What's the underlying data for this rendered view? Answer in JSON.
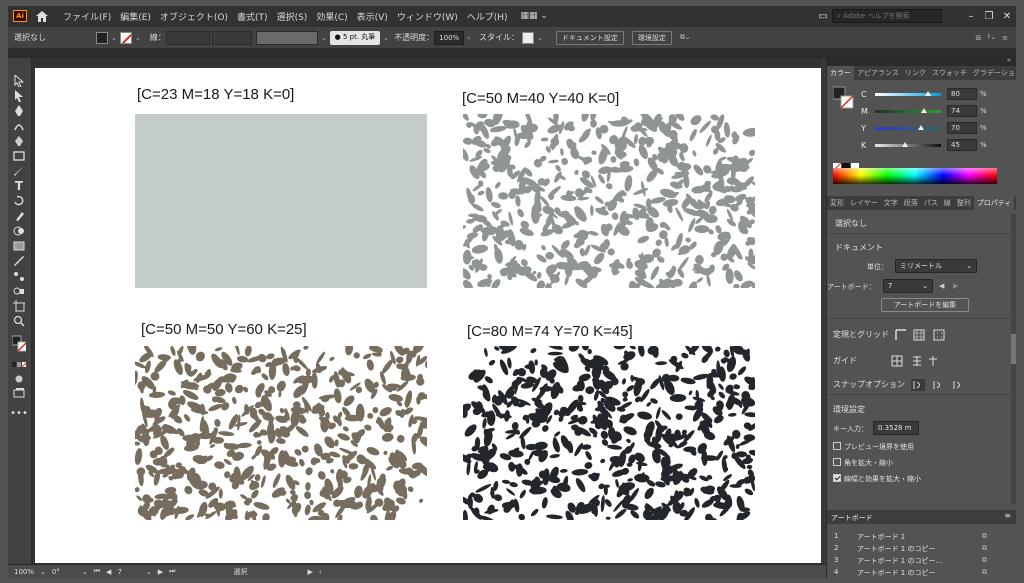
{
  "menubar": {
    "app_logo": "Ai",
    "items": [
      "ファイル(F)",
      "編集(E)",
      "オブジェクト(O)",
      "書式(T)",
      "選択(S)",
      "効果(C)",
      "表示(V)",
      "ウィンドウ(W)",
      "ヘルプ(H)"
    ],
    "search_placeholder": "Adobe ヘルプを検索"
  },
  "controlbar": {
    "selection_label": "選択なし",
    "stroke_label": "線：",
    "brush_label": "5 pt. 丸筆",
    "opacity_label": "不透明度：",
    "opacity_value": "100%",
    "style_label": "スタイル：",
    "doc_setup_button": "ドキュメント設定",
    "prefs_button": "環境設定"
  },
  "canvas": {
    "tiles": [
      {
        "caption": "[C=23 M=18 Y=18 K=0]",
        "color": "#c5cdcc",
        "pattern": "solid"
      },
      {
        "caption": "[C=50 M=40 Y=40 K=0]",
        "color": "#8e9592",
        "pattern": "noise"
      },
      {
        "caption": "[C=50 M=50 Y=60 K=25]",
        "color": "#766d5e",
        "pattern": "noise"
      },
      {
        "caption": "[C=80 M=74 Y=70 K=45]",
        "color": "#23272b",
        "pattern": "noise"
      }
    ]
  },
  "statusbar": {
    "zoom": "100%",
    "rotation": "0°",
    "artboard_num": "7",
    "mode": "選択"
  },
  "color_panel": {
    "tabs": [
      "カラー",
      "アピアランス",
      "リンク",
      "スウォッチ",
      "グラデーション"
    ],
    "channels": [
      {
        "label": "C",
        "value": "80",
        "unit": "%",
        "level": 0.8,
        "gradient": "linear-gradient(to right,#ffffff,#00a0e0)"
      },
      {
        "label": "M",
        "value": "74",
        "unit": "%",
        "level": 0.74,
        "gradient": "linear-gradient(to right,#203030,#2ea02e)"
      },
      {
        "label": "Y",
        "value": "70",
        "unit": "%",
        "level": 0.7,
        "gradient": "linear-gradient(to right,#2b3ad0,#2a6a5a)"
      },
      {
        "label": "K",
        "value": "45",
        "unit": "%",
        "level": 0.45,
        "gradient": "linear-gradient(to right,#e8e8e8,#111111)"
      }
    ]
  },
  "properties_panel": {
    "tabs": [
      "変形",
      "レイヤー",
      "文字",
      "段落",
      "パス",
      "線",
      "整列",
      "プロパティ"
    ],
    "selection": "選択なし",
    "document_heading": "ドキュメント",
    "unit_label": "単位：",
    "unit_value": "ミリメートル",
    "artboard_label": "アートボード：",
    "artboard_value": "7",
    "edit_artboard_button": "アートボードを編集",
    "ruler_grid_label": "定規とグリッド",
    "guides_label": "ガイド",
    "snap_label": "スナップオプション",
    "prefs_heading": "環境設定",
    "key_increment_label": "キー入力：",
    "key_increment_value": "0.3528 m",
    "checkbox_preview": "プレビュー境界を使用",
    "checkbox_corners": "角を拡大・縮小",
    "checkbox_strokes": "線幅と効果を拡大・縮小",
    "checkbox_strokes_checked": true
  },
  "artboard_panel": {
    "title": "アートボード",
    "rows": [
      {
        "num": "1",
        "name": "アートボード 1"
      },
      {
        "num": "2",
        "name": "アートボード 1 のコピー"
      },
      {
        "num": "3",
        "name": "アートボード 1 のコピー..."
      },
      {
        "num": "4",
        "name": "アートボード 1 のコピー"
      }
    ]
  }
}
